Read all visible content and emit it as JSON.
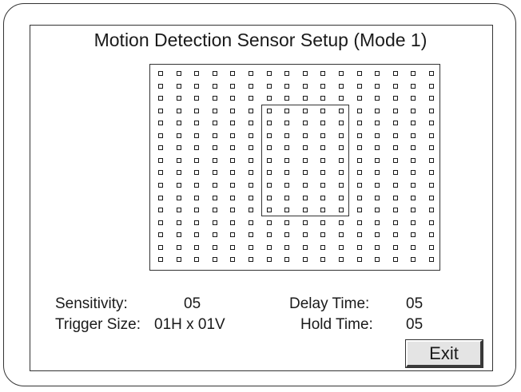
{
  "screen": {
    "title": "Motion Detection Sensor Setup (Mode 1)"
  },
  "grid": {
    "columns": 16,
    "rows": 16,
    "zone": {
      "col_start": 6,
      "col_end": 10,
      "row_start": 3,
      "row_end": 11
    }
  },
  "settings": {
    "sensitivity_label": "Sensitivity:",
    "sensitivity_value": "05",
    "trigger_size_label": "Trigger Size:",
    "trigger_size_value": "01H x 01V",
    "delay_time_label": "Delay Time:",
    "delay_time_value": "05",
    "hold_time_label": "Hold Time:",
    "hold_time_value": "05"
  },
  "buttons": {
    "exit_label": "Exit"
  }
}
